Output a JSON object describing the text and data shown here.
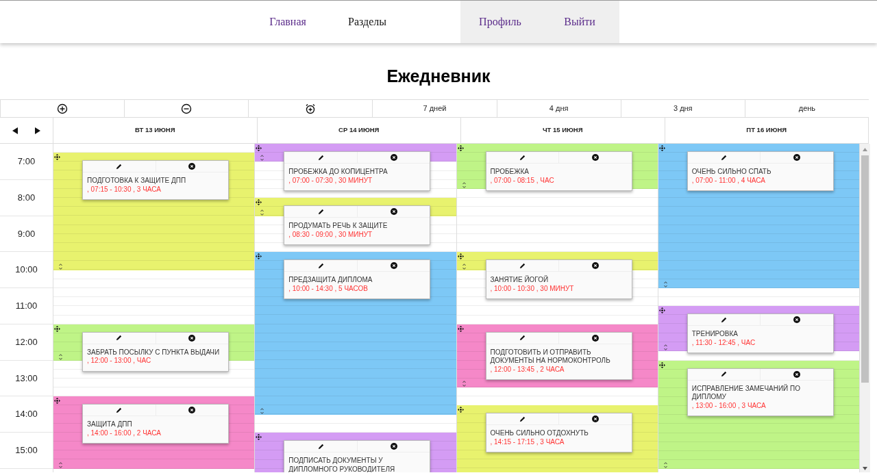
{
  "nav": [
    {
      "label": "Главная",
      "kind": "link"
    },
    {
      "label": "Разделы",
      "kind": "plain"
    },
    {
      "label": "Профиль",
      "kind": "user"
    },
    {
      "label": "Выйти",
      "kind": "user"
    }
  ],
  "title": "Ежедневник",
  "toolbar": [
    {
      "kind": "add"
    },
    {
      "kind": "remove"
    },
    {
      "kind": "alarm"
    },
    {
      "kind": "text",
      "label": "7 дней"
    },
    {
      "kind": "text",
      "label": "4 дня"
    },
    {
      "kind": "text",
      "label": "3 дня"
    },
    {
      "kind": "text",
      "label": "день"
    }
  ],
  "hours": [
    "7:00",
    "8:00",
    "9:00",
    "10:00",
    "11:00",
    "12:00",
    "13:00",
    "14:00",
    "15:00"
  ],
  "days": [
    {
      "label": "ВТ 13 ИЮНЯ",
      "events": [
        {
          "title": "ПОДГОТОВКА К ЗАЩИТЕ ДПП",
          "time": ", 07:15 - 10:30 , 3 ЧАСА",
          "color": "#e8f26e"
        },
        {
          "title": "ЗАБРАТЬ ПОСЫЛКУ С ПУНКТА ВЫДАЧИ",
          "time": ", 12:00 - 13:00 , ЧАС",
          "color": "#bff487"
        },
        {
          "title": "ЗАЩИТА ДПП",
          "time": ", 14:00 - 16:00 , 2 ЧАСА",
          "color": "#f588c8"
        }
      ]
    },
    {
      "label": "СР 14 ИЮНЯ",
      "events": [
        {
          "title": "ПРОБЕЖКА ДО КОПИЦЕНТРА",
          "time": ", 07:00 - 07:30 , 30 МИНУТ",
          "color": "#d49cf4"
        },
        {
          "title": "ПРОДУМАТЬ РЕЧЬ К ЗАЩИТЕ",
          "time": ", 08:30 - 09:00 , 30 МИНУТ",
          "color": "#e8f26e"
        },
        {
          "title": "ПРЕДЗАЩИТА ДИПЛОМА",
          "time": ", 10:00 - 14:30 , 5 ЧАСОВ",
          "color": "#7dc8f6"
        },
        {
          "title": "ПОДПИСАТЬ ДОКУМЕНТЫ У ДИПЛОМНОГО РУКОВОДИТЕЛЯ",
          "color": "#d49cf4"
        }
      ]
    },
    {
      "label": "ЧТ 15 ИЮНЯ",
      "events": [
        {
          "title": "ПРОБЕЖКА",
          "time": ", 07:00 - 08:15 , ЧАС",
          "color": "#bff487"
        },
        {
          "title": "ЗАНЯТИЕ ЙОГОЙ",
          "time": ", 10:00 - 10:30 , 30 МИНУТ",
          "color": "#e8f26e"
        },
        {
          "title": "ПОДГОТОВИТЬ И ОТПРАВИТЬ ДОКУМЕНТЫ НА НОРМОКОНТРОЛЬ",
          "time": ", 12:00 - 13:45 , 2 ЧАСА",
          "color": "#f588c8"
        },
        {
          "title": "ОЧЕНЬ СИЛЬНО ОТДОХНУТЬ",
          "time": ", 14:15 - 17:15 , 3 ЧАСА",
          "color": "#e8f26e"
        }
      ]
    },
    {
      "label": "ПТ 16 ИЮНЯ",
      "events": [
        {
          "title": "ОЧЕНЬ СИЛЬНО СПАТЬ",
          "time": ", 07:00 - 11:00 , 4 ЧАСА",
          "color": "#7dc8f6"
        },
        {
          "title": "ТРЕНИРОВКА",
          "time": ", 11:30 - 12:45 , ЧАС",
          "color": "#d49cf4"
        },
        {
          "title": "ИСПРАВЛЕНИЕ ЗАМЕЧАНИЙ ПО ДИПЛОМУ",
          "time": ", 13:00 - 16:00 , 3 ЧАСА",
          "color": "#bff487"
        }
      ]
    }
  ]
}
